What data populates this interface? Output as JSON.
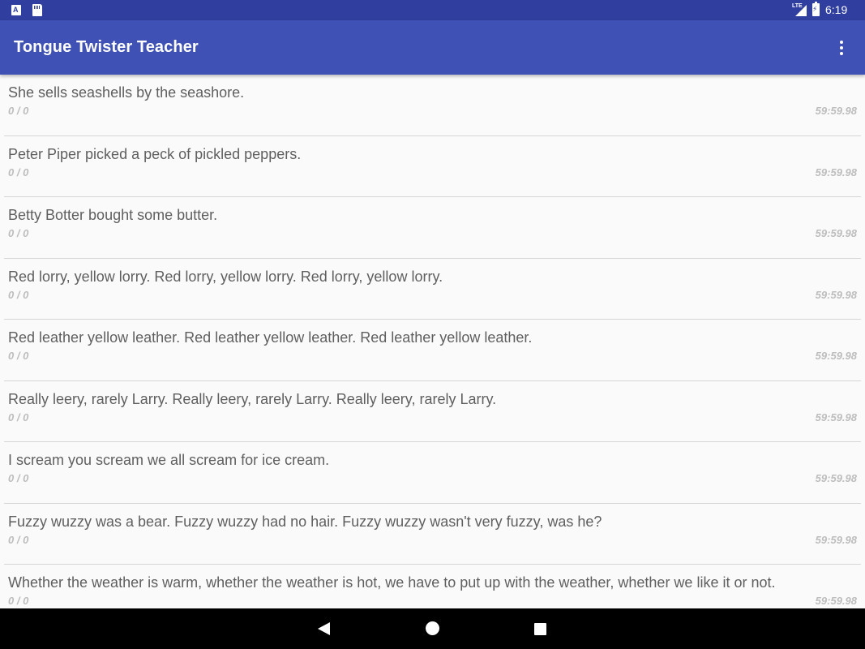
{
  "status_bar": {
    "left_icons": [
      "a-notification-icon",
      "sd-card-icon"
    ],
    "network": "LTE",
    "time": "6:19"
  },
  "app_bar": {
    "title": "Tongue Twister Teacher",
    "overflow_icon": "more-vert-icon"
  },
  "twisters": [
    {
      "text": "She sells seashells by the seashore.",
      "score": "0 / 0",
      "time": "59:59.98"
    },
    {
      "text": "Peter Piper picked a peck of pickled peppers.",
      "score": "0 / 0",
      "time": "59:59.98"
    },
    {
      "text": "Betty Botter bought some butter.",
      "score": "0 / 0",
      "time": "59:59.98"
    },
    {
      "text": "Red lorry, yellow lorry. Red lorry, yellow lorry. Red lorry, yellow lorry.",
      "score": "0 / 0",
      "time": "59:59.98"
    },
    {
      "text": "Red leather yellow leather. Red leather yellow leather. Red leather yellow leather.",
      "score": "0 / 0",
      "time": "59:59.98"
    },
    {
      "text": "Really leery, rarely Larry. Really leery, rarely Larry. Really leery, rarely Larry.",
      "score": "0 / 0",
      "time": "59:59.98"
    },
    {
      "text": "I scream you scream we all scream for ice cream.",
      "score": "0 / 0",
      "time": "59:59.98"
    },
    {
      "text": "Fuzzy wuzzy was a bear. Fuzzy wuzzy had no hair. Fuzzy wuzzy wasn't very fuzzy, was he?",
      "score": "0 / 0",
      "time": "59:59.98"
    },
    {
      "text": "Whether the weather is warm, whether the weather is hot, we have to put up with the weather, whether we like it or not.",
      "score": "0 / 0",
      "time": "59:59.98"
    }
  ],
  "nav_bar": {
    "buttons": [
      "back-icon",
      "home-icon",
      "recents-icon"
    ]
  },
  "colors": {
    "status_bar": "#303f9f",
    "app_bar": "#3f51b5",
    "background": "#fafafa",
    "text_primary": "#5f5f5f",
    "text_secondary": "#bdbdbd"
  }
}
